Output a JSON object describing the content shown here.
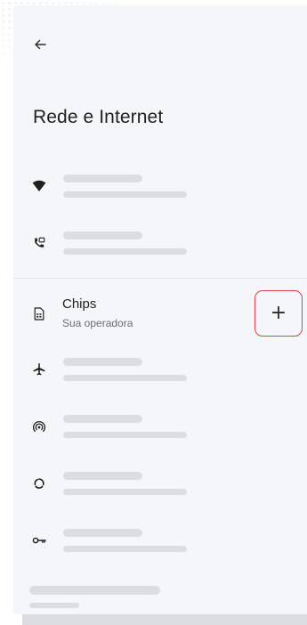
{
  "header": {
    "back_icon": "arrow-left-icon",
    "title": "Rede e Internet"
  },
  "list": {
    "items": [
      {
        "icon": "wifi-icon",
        "placeholder": true
      },
      {
        "icon": "phone-wifi-calling-icon",
        "placeholder": true
      },
      {
        "icon": "sim-card-icon",
        "title": "Chips",
        "subtitle": "Sua operadora",
        "action": "add-icon",
        "action_label": "+"
      },
      {
        "icon": "airplane-icon",
        "placeholder": true
      },
      {
        "icon": "hotspot-icon",
        "placeholder": true
      },
      {
        "icon": "data-saver-icon",
        "placeholder": true
      },
      {
        "icon": "vpn-key-icon",
        "placeholder": true
      }
    ]
  },
  "colors": {
    "panel_bg": "#f5f6fa",
    "skeleton": "#dcdde2",
    "accent_border": "#e0424a",
    "text_primary": "#1f1f1f",
    "text_secondary": "#6b6d73"
  }
}
